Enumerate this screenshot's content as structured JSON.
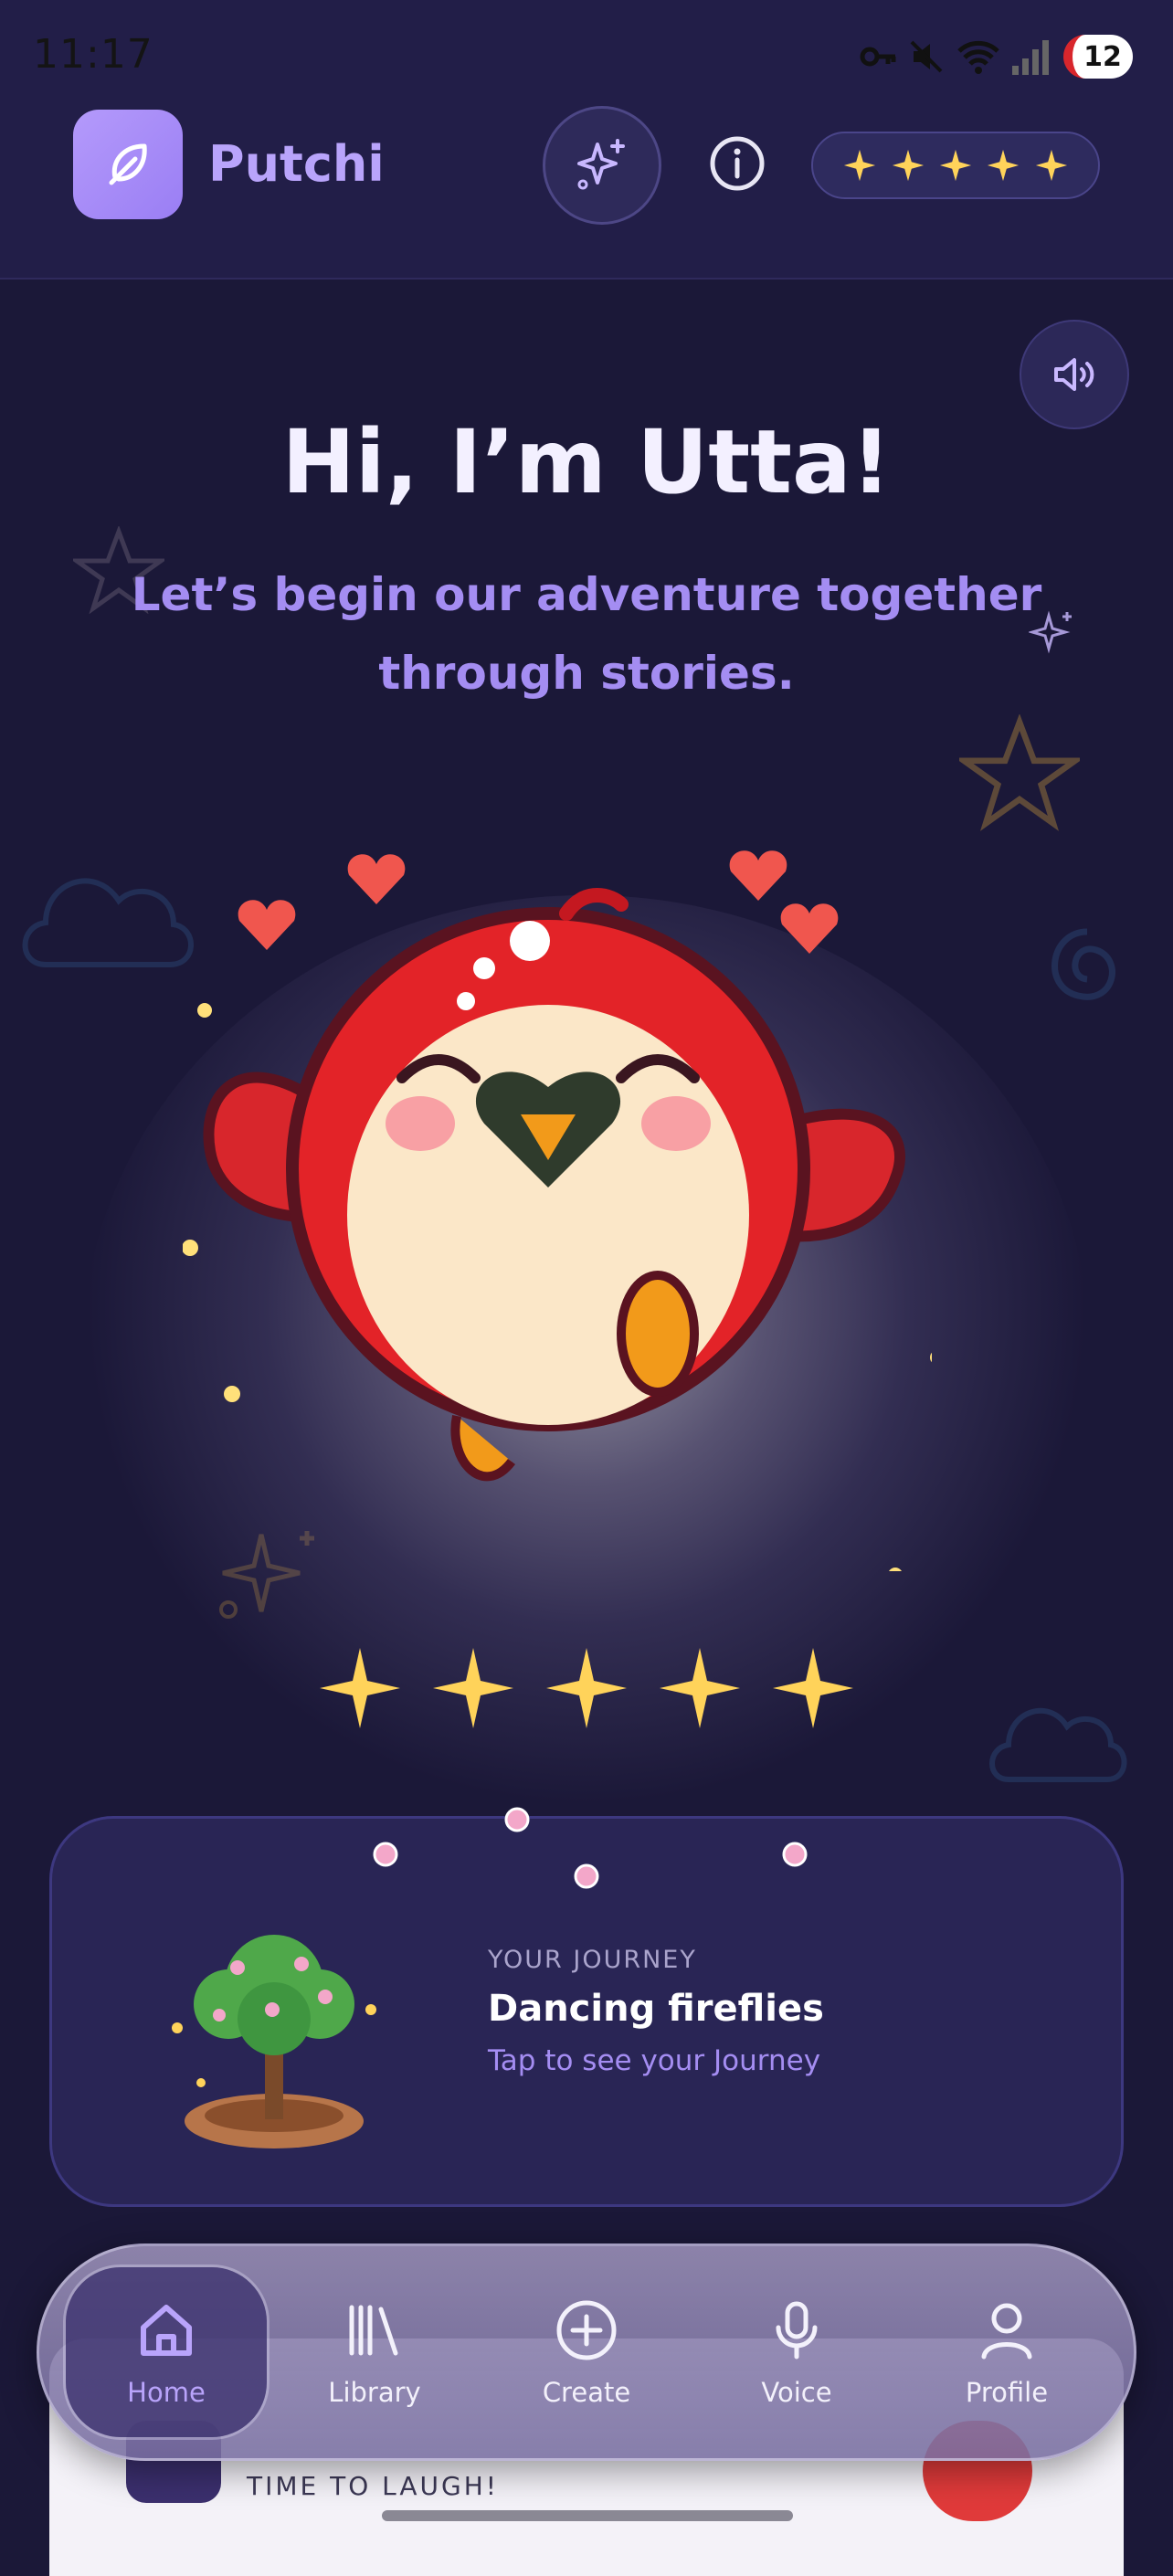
{
  "status_bar": {
    "time": "11:17",
    "battery": "12"
  },
  "header": {
    "app_name": "Putchi",
    "stars_count": 5
  },
  "greeting": {
    "title": "Hi, I’m Utta!",
    "subtitle": "Let’s begin our adventure together through stories."
  },
  "mascot": {
    "rating_stars": 5
  },
  "journey": {
    "kicker": "YOUR JOURNEY",
    "title": "Dancing fireflies",
    "cta": "Tap to see your Journey"
  },
  "sheet": {
    "label": "TIME TO LAUGH!"
  },
  "nav": {
    "items": [
      {
        "label": "Home",
        "icon": "home-icon",
        "active": true
      },
      {
        "label": "Library",
        "icon": "library-icon",
        "active": false
      },
      {
        "label": "Create",
        "icon": "plus-circle-icon",
        "active": false
      },
      {
        "label": "Voice",
        "icon": "microphone-icon",
        "active": false
      },
      {
        "label": "Profile",
        "icon": "user-icon",
        "active": false
      }
    ]
  },
  "colors": {
    "background": "#1b1838",
    "accent": "#b49afb",
    "star": "#ffd35a",
    "mascot_red": "#d8262c"
  }
}
